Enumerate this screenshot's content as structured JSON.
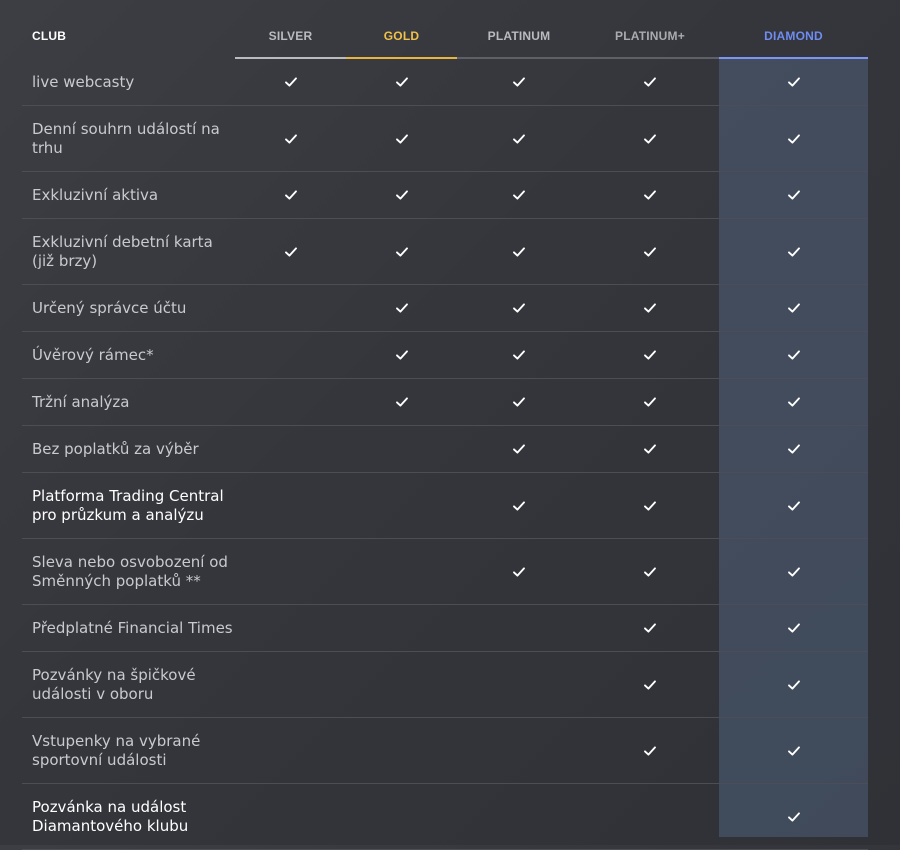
{
  "header": {
    "club": "CLUB",
    "tiers": [
      "SILVER",
      "GOLD",
      "PLATINUM",
      "PLATINUM+",
      "DIAMOND"
    ]
  },
  "colors": {
    "silver": "#b9bbbf",
    "gold": "#f2c14a",
    "platinum": "#b9bbbf",
    "platinum_plus": "#a9abaf",
    "diamond": "#6f8cf0",
    "check": "#ffffff"
  },
  "icons": {
    "check": "checkmark-icon"
  },
  "rows": [
    {
      "label": "live webcasty",
      "checks": [
        true,
        true,
        true,
        true,
        true
      ]
    },
    {
      "label": "Denní souhrn událostí na trhu",
      "checks": [
        true,
        true,
        true,
        true,
        true
      ]
    },
    {
      "label": "Exkluzivní aktiva",
      "checks": [
        true,
        true,
        true,
        true,
        true
      ]
    },
    {
      "label": "Exkluzivní debetní karta (již brzy)",
      "checks": [
        true,
        true,
        true,
        true,
        true
      ]
    },
    {
      "label": "Určený správce účtu",
      "checks": [
        false,
        true,
        true,
        true,
        true
      ]
    },
    {
      "label": "Úvěrový rámec*",
      "checks": [
        false,
        true,
        true,
        true,
        true
      ]
    },
    {
      "label": "Tržní analýza",
      "checks": [
        false,
        true,
        true,
        true,
        true
      ]
    },
    {
      "label": "Bez poplatků za výběr",
      "checks": [
        false,
        false,
        true,
        true,
        true
      ]
    },
    {
      "label": "Platforma Trading Central pro průzkum a analýzu",
      "checks": [
        false,
        false,
        true,
        true,
        true
      ]
    },
    {
      "label": "Sleva nebo osvobození od Směnných poplatků **",
      "checks": [
        false,
        false,
        true,
        true,
        true
      ]
    },
    {
      "label": "Předplatné Financial Times",
      "checks": [
        false,
        false,
        false,
        true,
        true
      ]
    },
    {
      "label": "Pozvánky na špičkové události v oboru",
      "checks": [
        false,
        false,
        false,
        true,
        true
      ]
    },
    {
      "label": "Vstupenky na vybrané sportovní události",
      "checks": [
        false,
        false,
        false,
        true,
        true
      ]
    },
    {
      "label": "Pozvánka na událost Diamantového klubu",
      "checks": [
        false,
        false,
        false,
        false,
        true
      ]
    }
  ]
}
